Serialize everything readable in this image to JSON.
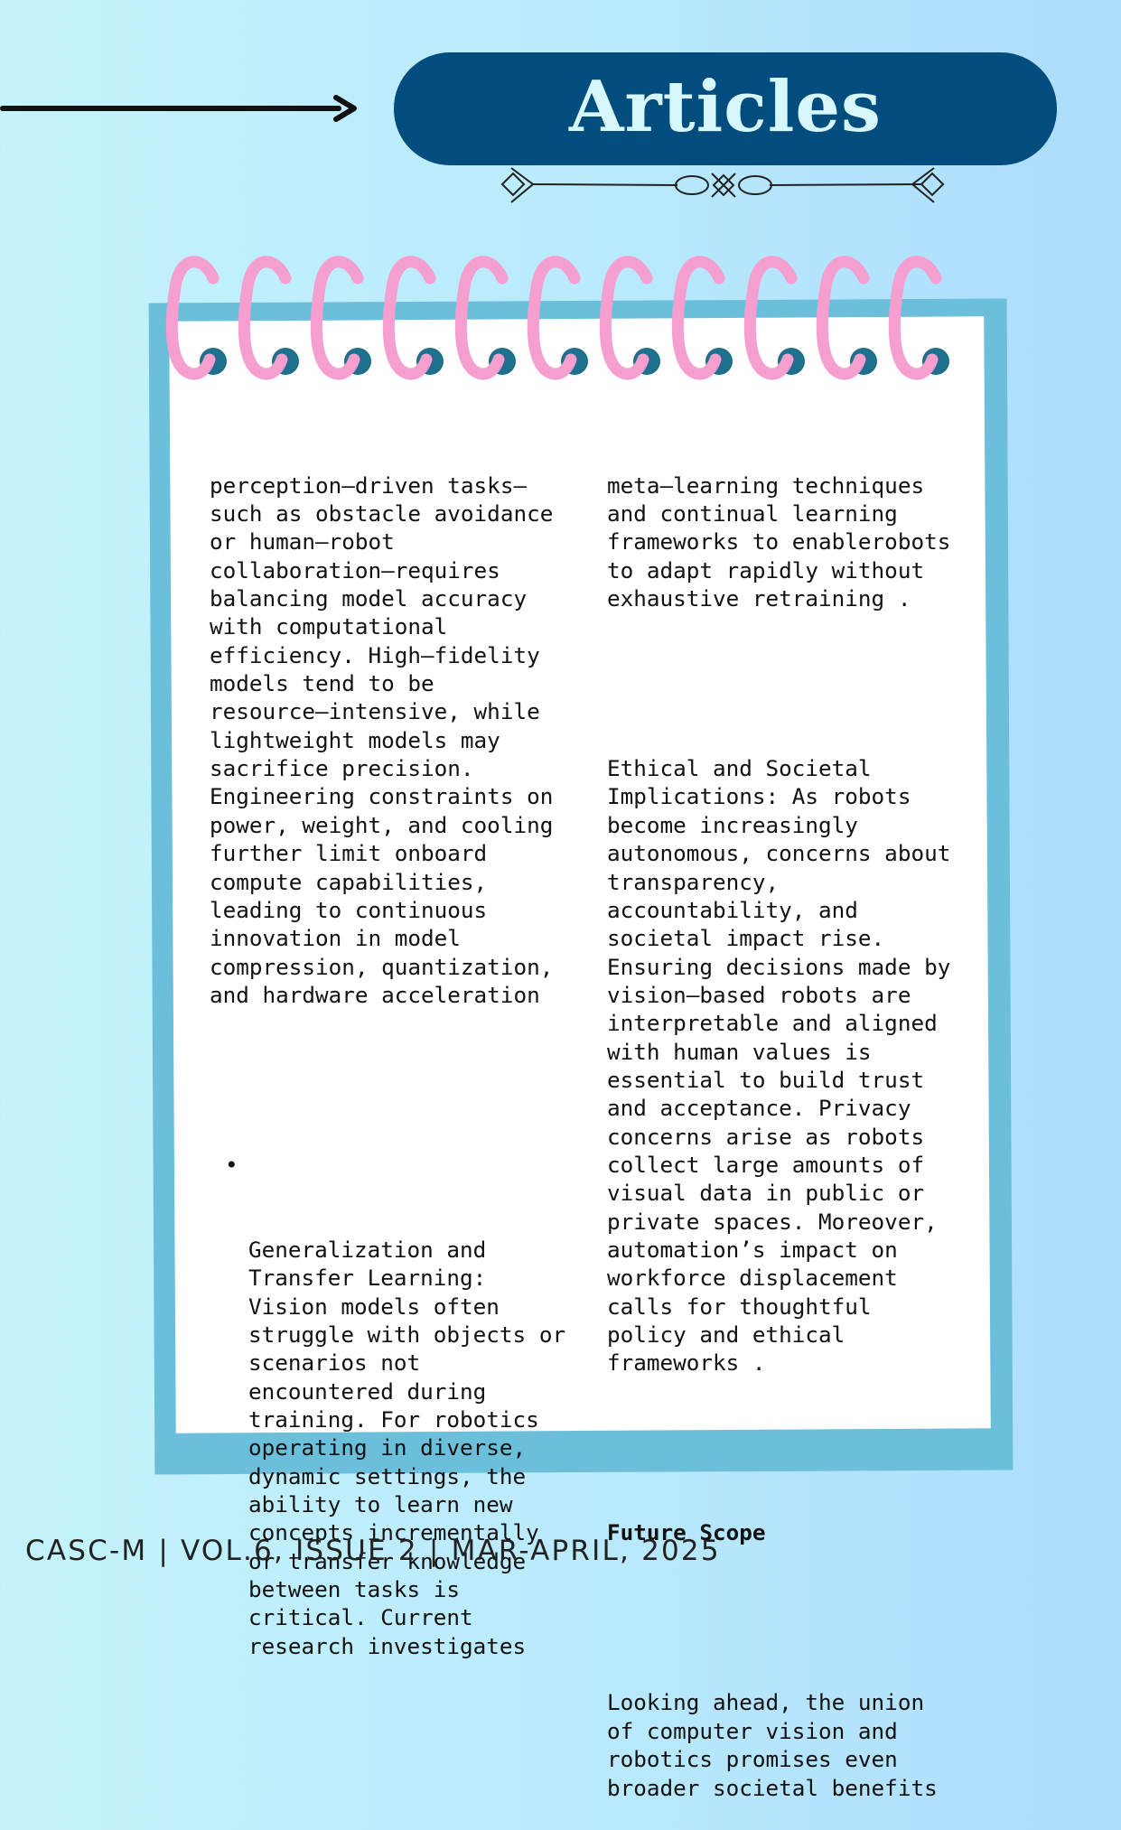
{
  "header": {
    "title": "Articles",
    "decoration": {
      "arrow_icon": "right-arrow-icon",
      "flourish_icon": "ornamental-divider-icon",
      "binder_icon": "spiral-binding-icon"
    }
  },
  "colors": {
    "title_pill": "#024d7e",
    "title_text": "#d6f8fc",
    "card_border": "#6bbfdb",
    "spiral_ring": "#f59fd0",
    "spiral_hole": "#1f6f8f"
  },
  "article": {
    "left_column": {
      "intro_lines": [
        "perception–driven tasks–",
        "such as obstacle avoidance",
        "or human–robot",
        "collaboration–requires",
        "balancing model accuracy",
        "with computational",
        "efficiency. High–fidelity",
        "models tend to be",
        "resource–intensive, while",
        "lightweight models may",
        "sacrifice precision.",
        "Engineering constraints on",
        "power, weight, and cooling",
        "further limit onboard",
        "compute capabilities,",
        "leading to continuous",
        "innovation in model",
        "compression, quantization,",
        "and hardware acceleration"
      ],
      "bullet_lines": [
        "Generalization and",
        "Transfer Learning:",
        "Vision models often",
        "struggle with objects or",
        "scenarios not",
        "encountered during",
        "training. For robotics",
        "operating in diverse,",
        "dynamic settings, the",
        "ability to learn new",
        "concepts incrementally",
        "or transfer knowledge",
        "between tasks is",
        "critical. Current",
        "research investigates"
      ],
      "bullet_glyph": "•"
    },
    "right_column": {
      "continuation_lines": [
        "meta–learning techniques",
        "and continual learning",
        "frameworks to enablerobots",
        "to adapt rapidly without",
        "exhaustive retraining ."
      ],
      "ethics_lines": [
        "Ethical and Societal",
        "Implications: As robots",
        "become increasingly",
        "autonomous, concerns about",
        "transparency,",
        "accountability, and",
        "societal impact rise.",
        "Ensuring decisions made by",
        "vision–based robots are",
        "interpretable and aligned",
        "with human values is",
        "essential to build trust",
        "and acceptance. Privacy",
        "concerns arise as robots",
        "collect large amounts of",
        "visual data in public or",
        "private spaces. Moreover,",
        "automation’s impact on",
        "workforce displacement",
        "calls for thoughtful",
        "policy and ethical",
        "frameworks ."
      ],
      "future_heading": "Future Scope",
      "future_lines": [
        "Looking ahead, the union",
        "of computer vision and",
        "robotics promises even",
        "broader societal benefits"
      ]
    }
  },
  "footer": {
    "text": "CASC-M | VOL.6, ISSUE 2 | MAR-APRIL, 2025"
  }
}
